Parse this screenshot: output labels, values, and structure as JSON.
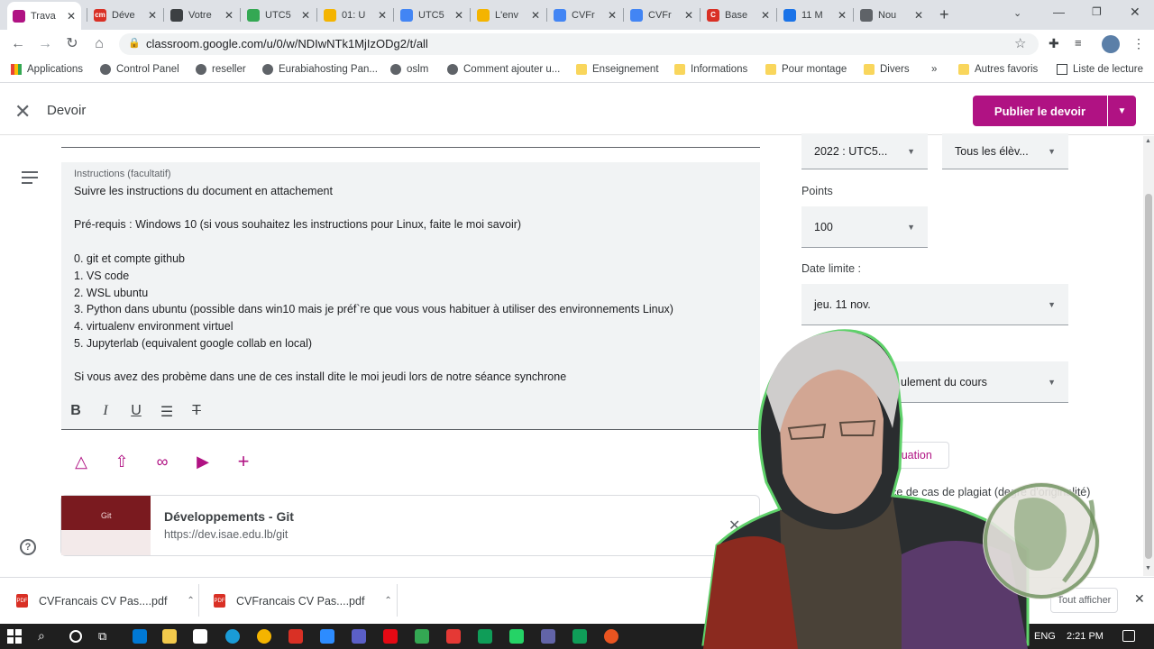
{
  "browser": {
    "tabs": [
      {
        "label": "Trava",
        "color": "#b01283",
        "glyph": ""
      },
      {
        "label": "Déve",
        "color": "#d93025",
        "glyph": "cm"
      },
      {
        "label": "Votre",
        "color": "#3c4043",
        "glyph": ""
      },
      {
        "label": "UTC5",
        "color": "#34a853",
        "glyph": ""
      },
      {
        "label": "01: U",
        "color": "#f4b400",
        "glyph": ""
      },
      {
        "label": "UTC5",
        "color": "#4285f4",
        "glyph": ""
      },
      {
        "label": "L'env",
        "color": "#f4b400",
        "glyph": ""
      },
      {
        "label": "CVFr",
        "color": "#4285f4",
        "glyph": ""
      },
      {
        "label": "CVFr",
        "color": "#4285f4",
        "glyph": ""
      },
      {
        "label": "Base",
        "color": "#d93025",
        "glyph": "C"
      },
      {
        "label": "11 M",
        "color": "#1a73e8",
        "glyph": ""
      },
      {
        "label": "Nou",
        "color": "#5f6368",
        "glyph": ""
      }
    ],
    "url": "classroom.google.com/u/0/w/NDIwNTk1MjIzODg2/t/all",
    "bookmarks": [
      {
        "label": "Applications",
        "kind": "apps"
      },
      {
        "label": "Control Panel",
        "kind": "icon"
      },
      {
        "label": "reseller",
        "kind": "icon"
      },
      {
        "label": "Eurabiahosting Pan...",
        "kind": "icon"
      },
      {
        "label": "oslm",
        "kind": "icon"
      },
      {
        "label": "Comment ajouter u...",
        "kind": "icon"
      },
      {
        "label": "Enseignement",
        "kind": "folder"
      },
      {
        "label": "Informations",
        "kind": "folder"
      },
      {
        "label": "Pour montage",
        "kind": "folder"
      },
      {
        "label": "Divers",
        "kind": "folder"
      },
      {
        "label": "»",
        "kind": "chevron"
      },
      {
        "label": "Autres favoris",
        "kind": "folder"
      },
      {
        "label": "Liste de lecture",
        "kind": "list"
      }
    ]
  },
  "header": {
    "title": "Devoir",
    "publish_label": "Publier le devoir"
  },
  "instructions": {
    "label": "Instructions (facultatif)",
    "lines": [
      "Suivre les instructions du document en attachement",
      "Pré-requis : Windows 10 (si vous souhaitez les instructions pour Linux, faite le moi savoir)",
      "0. git et compte github",
      "1. VS code",
      "2. WSL ubuntu",
      "3. Python dans ubuntu (possible dans win10 mais je préf`re que vous vous habituer à utiliser des environnements Linux)",
      "4. virtualenv environment virtuel",
      "5. Jupyterlab (equivalent google collab en local)",
      "Si vous avez des probème dans une de ces install dite le moi jeudi lors de notre séance synchrone"
    ]
  },
  "attachment": {
    "title": "Développements - Git",
    "url": "https://dev.isae.edu.lb/git",
    "thumb_label": "Git"
  },
  "settings": {
    "class_value": "2022 : UTC5...",
    "students_value": "Tous les élèv...",
    "points_label": "Points",
    "points_value": "100",
    "due_label": "Date limite :",
    "due_value": "jeu. 11 nov.",
    "topic_value": "ulement du cours",
    "rubric_label": "aluation",
    "plagiarism_label": "sence de cas de plagiat (degré d'originalité)"
  },
  "downloads": {
    "items": [
      "CVFrancais CV Pas....pdf",
      "CVFrancais CV Pas....pdf"
    ],
    "show_all": "Tout afficher"
  },
  "taskbar": {
    "lang": "ENG",
    "time": "2:21 PM"
  }
}
